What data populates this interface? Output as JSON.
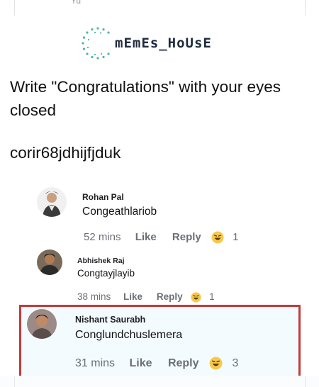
{
  "top_fragment": "Yu",
  "logo": {
    "text": "mEmEs_HoUsE"
  },
  "post": {
    "text": "Write \"Congratulations\" with your eyes closed",
    "gibberish": "corir68jdhijfjduk"
  },
  "comments": [
    {
      "name": "Rohan Pal",
      "text": "Congeathlariob",
      "time": "52 mins",
      "like": "Like",
      "reply": "Reply",
      "reactions": "1"
    },
    {
      "name": "Abhishek Raj",
      "text": "Congtayjlayib",
      "time": "38 mins",
      "like": "Like",
      "reply": "Reply",
      "reactions": "1"
    },
    {
      "name": "Nishant Saurabh",
      "text": "Conglundchuslemera",
      "time": "31 mins",
      "like": "Like",
      "reply": "Reply",
      "reactions": "3"
    }
  ],
  "colors": {
    "highlight_border": "#c43b3b",
    "highlight_bg": "#f4fbff",
    "logo_dots": "#4fb3a9"
  },
  "icons": [
    "haha-emoji-icon",
    "avatar-icon",
    "logo-ring-icon"
  ]
}
